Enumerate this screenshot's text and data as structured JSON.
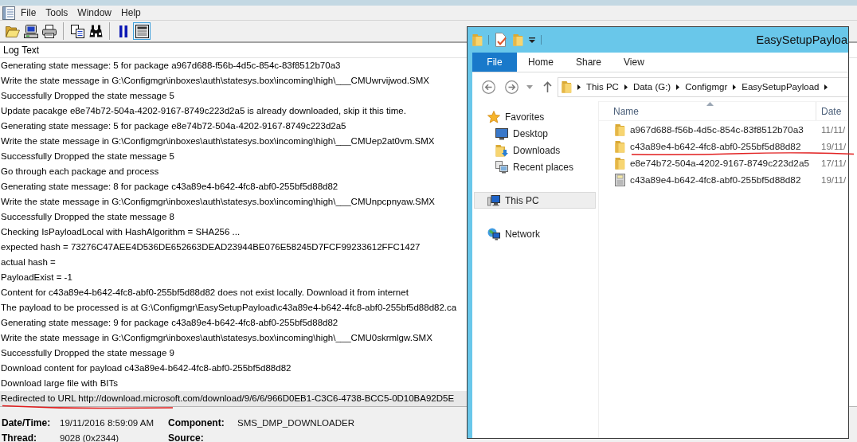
{
  "app": {
    "menu": [
      "File",
      "Tools",
      "Window",
      "Help"
    ],
    "toolbar": [
      [
        {
          "kind": "open",
          "pressed": false
        },
        {
          "kind": "computer",
          "pressed": false
        },
        {
          "kind": "print",
          "pressed": false
        }
      ],
      [
        {
          "kind": "copy",
          "pressed": false
        },
        {
          "kind": "find",
          "pressed": false
        }
      ],
      [
        {
          "kind": "pause",
          "pressed": false
        },
        {
          "kind": "view",
          "pressed": true
        }
      ]
    ]
  },
  "log": {
    "column": "Log Text",
    "lines": [
      {
        "text": "Generating state message: 5 for package a967d688-f56b-4d5c-854c-83f8512b70a3",
        "selected": false,
        "underlined": false
      },
      {
        "text": "Write the state message in G:\\Configmgr\\inboxes\\auth\\statesys.box\\incoming\\high\\___CMUwrvijwod.SMX",
        "selected": false,
        "underlined": false
      },
      {
        "text": "Successfully Dropped the state message 5",
        "selected": false,
        "underlined": false
      },
      {
        "text": "Update pacakge e8e74b72-504a-4202-9167-8749c223d2a5 is already downloaded, skip it this time.",
        "selected": false,
        "underlined": false
      },
      {
        "text": "Generating state message: 5 for package e8e74b72-504a-4202-9167-8749c223d2a5",
        "selected": false,
        "underlined": false
      },
      {
        "text": "Write the state message in G:\\Configmgr\\inboxes\\auth\\statesys.box\\incoming\\high\\___CMUep2at0vm.SMX",
        "selected": false,
        "underlined": false
      },
      {
        "text": "Successfully Dropped the state message 5",
        "selected": false,
        "underlined": false
      },
      {
        "text": "Go through each package and process",
        "selected": false,
        "underlined": false
      },
      {
        "text": "Generating state message: 8 for package c43a89e4-b642-4fc8-abf0-255bf5d88d82",
        "selected": false,
        "underlined": false
      },
      {
        "text": "Write the state message in G:\\Configmgr\\inboxes\\auth\\statesys.box\\incoming\\high\\___CMUnpcpnyaw.SMX",
        "selected": false,
        "underlined": false
      },
      {
        "text": "Successfully Dropped the state message 8",
        "selected": false,
        "underlined": false
      },
      {
        "text": "Checking IsPayloadLocal with HashAlgorithm = SHA256 ...",
        "selected": false,
        "underlined": false
      },
      {
        "text": "expected hash = 73276C47AEE4D536DE652663DEAD23944BE076E58245D7FCF99233612FFC1427",
        "selected": false,
        "underlined": false
      },
      {
        "text": "actual hash =",
        "selected": false,
        "underlined": false
      },
      {
        "text": "PayloadExist = -1",
        "selected": false,
        "underlined": false
      },
      {
        "text": "Content for c43a89e4-b642-4fc8-abf0-255bf5d88d82 does not exist locally. Download it from internet",
        "selected": false,
        "underlined": false
      },
      {
        "text": "The payload to be processed is at G:\\Configmgr\\EasySetupPayload\\c43a89e4-b642-4fc8-abf0-255bf5d88d82.ca",
        "selected": false,
        "underlined": false
      },
      {
        "text": "Generating state message: 9 for package c43a89e4-b642-4fc8-abf0-255bf5d88d82",
        "selected": false,
        "underlined": false
      },
      {
        "text": "Write the state message in G:\\Configmgr\\inboxes\\auth\\statesys.box\\incoming\\high\\___CMU0skrmlgw.SMX",
        "selected": false,
        "underlined": false
      },
      {
        "text": "Successfully Dropped the state message 9",
        "selected": false,
        "underlined": false
      },
      {
        "text": "Download content for payload c43a89e4-b642-4fc8-abf0-255bf5d88d82",
        "selected": false,
        "underlined": false
      },
      {
        "text": "Download large file with BITs",
        "selected": false,
        "underlined": false
      },
      {
        "text": "Redirected to URL http://download.microsoft.com/download/9/6/6/966D0EB1-C3C6-4738-BCC5-0D10BA92D5E",
        "selected": true,
        "underlined": true
      }
    ]
  },
  "details": [
    {
      "label": "Date/Time:",
      "value": "19/11/2016 8:59:09 AM"
    },
    {
      "label": "Component:",
      "value": "SMS_DMP_DOWNLOADER"
    },
    {
      "label": "Thread:",
      "value": "9028 (0x2344)"
    },
    {
      "label": "Source:"
    }
  ],
  "explorer": {
    "title": "EasySetupPayloa",
    "ribbon": [
      {
        "label": "File",
        "kind": "menu"
      },
      {
        "label": "Home",
        "kind": "tab"
      },
      {
        "label": "Share",
        "kind": "tab"
      },
      {
        "label": "View",
        "kind": "tab"
      }
    ],
    "address": [
      "This PC",
      "Data (G:)",
      "Configmgr",
      "EasySetupPayload"
    ],
    "nav": [
      {
        "label": "Favorites",
        "kind": "favorites",
        "selected": false,
        "children": [
          {
            "label": "Desktop",
            "kind": "desktop",
            "selected": false
          },
          {
            "label": "Downloads",
            "kind": "downloads",
            "selected": false
          },
          {
            "label": "Recent places",
            "kind": "recent",
            "selected": false
          }
        ]
      },
      {
        "label": "This PC",
        "kind": "pc",
        "selected": true
      },
      {
        "label": "Network",
        "kind": "network",
        "selected": false
      }
    ],
    "columns": [
      {
        "label": "Name",
        "sorted": true
      },
      {
        "label": "Date",
        "sorted": false
      }
    ],
    "files": [
      {
        "name": "a967d688-f56b-4d5c-854c-83f8512b70a3",
        "date": "11/11/",
        "kind": "folder",
        "underlined": false
      },
      {
        "name": "c43a89e4-b642-4fc8-abf0-255bf5d88d82",
        "date": "19/11/",
        "kind": "folder",
        "underlined": true
      },
      {
        "name": "e8e74b72-504a-4202-9167-8749c223d2a5",
        "date": "17/11/",
        "kind": "folder",
        "underlined": false
      },
      {
        "name": "c43a89e4-b642-4fc8-abf0-255bf5d88d82",
        "date": "19/11/",
        "kind": "file",
        "underlined": false
      }
    ]
  }
}
